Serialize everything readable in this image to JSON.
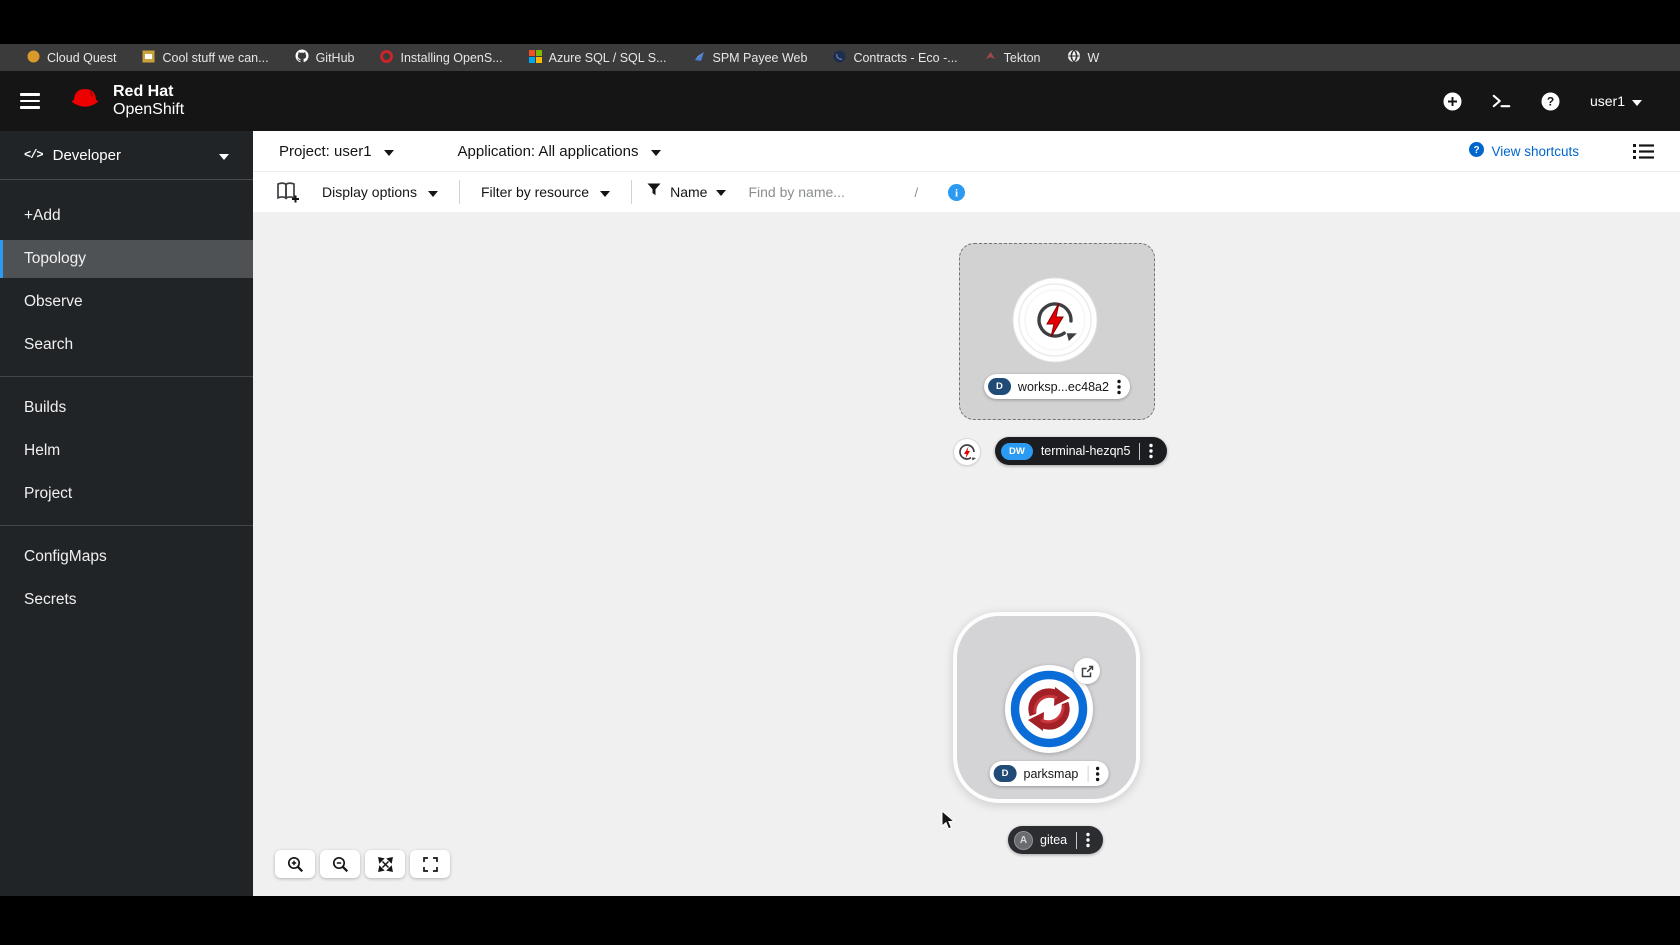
{
  "browser": {
    "bookmarks": [
      {
        "label": "Cloud Quest",
        "icon": "cloud-quest-favicon"
      },
      {
        "label": "Cool stuff we can...",
        "icon": "folder-favicon"
      },
      {
        "label": "GitHub",
        "icon": "github-favicon"
      },
      {
        "label": "Installing OpenS...",
        "icon": "openshift-favicon"
      },
      {
        "label": "Azure SQL / SQL S...",
        "icon": "microsoft-favicon"
      },
      {
        "label": "SPM Payee Web",
        "icon": "payee-favicon"
      },
      {
        "label": "Contracts - Eco -...",
        "icon": "contracts-favicon"
      },
      {
        "label": "Tekton",
        "icon": "tekton-favicon"
      },
      {
        "label": "W",
        "icon": "globe-favicon"
      }
    ]
  },
  "masthead": {
    "brand_line1": "Red Hat",
    "brand_line2": "OpenShift",
    "user": "user1",
    "icons": [
      "add-circle-icon",
      "command-line-icon",
      "help-icon"
    ]
  },
  "sidebar": {
    "perspective": "Developer",
    "items": [
      {
        "label": "+Add",
        "selected": false
      },
      {
        "label": "Topology",
        "selected": true
      },
      {
        "label": "Observe",
        "selected": false
      },
      {
        "label": "Search",
        "selected": false
      },
      {
        "label": "Builds",
        "selected": false
      },
      {
        "label": "Helm",
        "selected": false
      },
      {
        "label": "Project",
        "selected": false
      },
      {
        "label": "ConfigMaps",
        "selected": false
      },
      {
        "label": "Secrets",
        "selected": false
      }
    ]
  },
  "context_bar": {
    "project_label": "Project: user1",
    "application_label": "Application: All applications",
    "view_shortcuts_label": "View shortcuts"
  },
  "toolbar": {
    "display_options_label": "Display options",
    "filter_by_resource_label": "Filter by resource",
    "filter_type_label": "Name",
    "search_placeholder": "Find by name...",
    "shortcut_key": "/"
  },
  "topology": {
    "workspace_node": {
      "badge": "D",
      "label": "worksp...ec48a2"
    },
    "terminal_node": {
      "badge": "DW",
      "label": "terminal-hezqn5"
    },
    "parksmap_node": {
      "badge": "D",
      "label": "parksmap"
    },
    "gitea_node": {
      "badge": "A",
      "label": "gitea"
    }
  },
  "zoom_controls": [
    "zoom-in",
    "zoom-out",
    "fit-to-screen",
    "fullscreen"
  ],
  "colors": {
    "accent_blue": "#0066cc",
    "badge_navy": "#204b77",
    "badge_blue": "#2b9af3",
    "masthead_bg": "#151515",
    "sidebar_bg": "#212427",
    "sidebar_selected": "#4f5255",
    "canvas_bg": "#f0f0f1",
    "node_gray": "#d2d2d2",
    "redhat_red": "#ee0000"
  }
}
